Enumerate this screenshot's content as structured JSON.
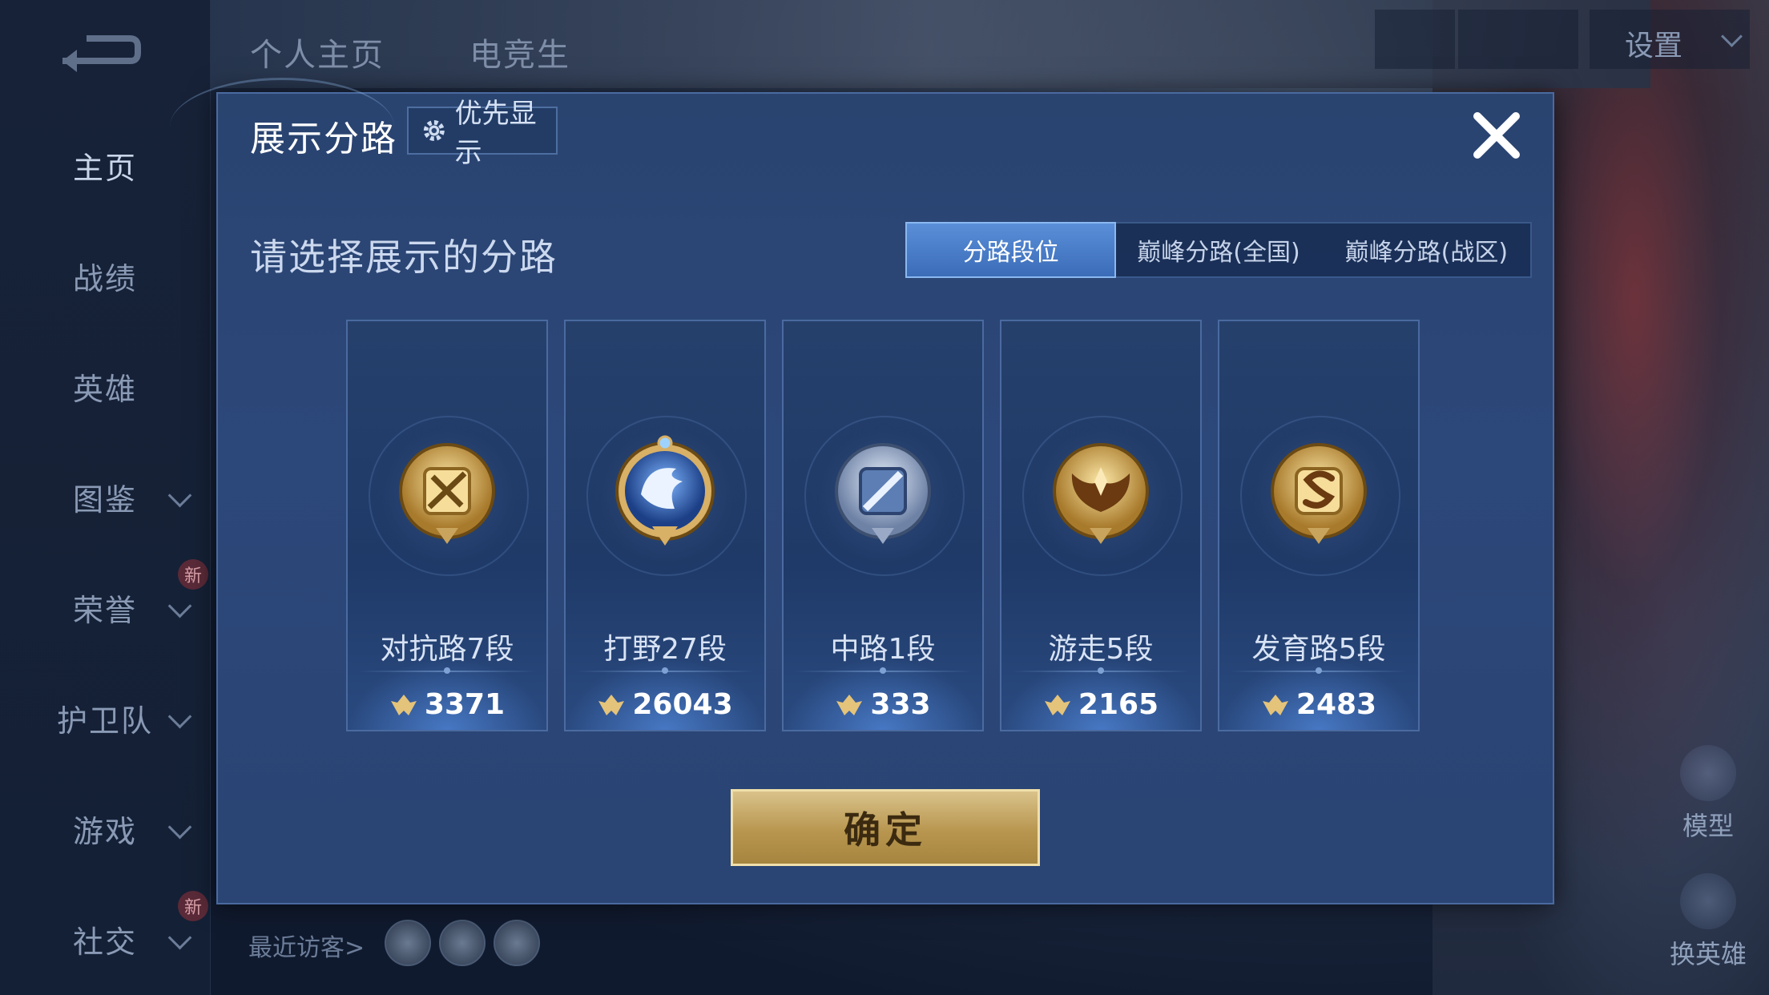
{
  "sidebar": {
    "items": [
      {
        "label": "主页",
        "chevron": false,
        "badge": ""
      },
      {
        "label": "战绩",
        "chevron": false,
        "badge": ""
      },
      {
        "label": "英雄",
        "chevron": false,
        "badge": ""
      },
      {
        "label": "图鉴",
        "chevron": true,
        "badge": ""
      },
      {
        "label": "荣誉",
        "chevron": true,
        "badge": "新"
      },
      {
        "label": "护卫队",
        "chevron": true,
        "badge": ""
      },
      {
        "label": "游戏",
        "chevron": true,
        "badge": ""
      },
      {
        "label": "社交",
        "chevron": true,
        "badge": "新"
      }
    ]
  },
  "header": {
    "tabs": [
      "个人主页",
      "电竞生"
    ],
    "settings_label": "设置"
  },
  "right_buttons": {
    "model_label": "模型",
    "switch_hero_label": "换英雄"
  },
  "footer": {
    "recent_visitors_label": "最近访客>"
  },
  "modal": {
    "title": "展示分路",
    "priority_label": "优先显示",
    "subtitle": "请选择展示的分路",
    "tabs": [
      "分路段位",
      "巅峰分路(全国)",
      "巅峰分路(战区)"
    ],
    "active_tab": 0,
    "lanes": [
      {
        "name": "对抗路7段",
        "score": "3371",
        "emblem": "sword-emblem-icon",
        "color": "gold"
      },
      {
        "name": "打野27段",
        "score": "26043",
        "emblem": "dragon-emblem-icon",
        "color": "blue"
      },
      {
        "name": "中路1段",
        "score": "333",
        "emblem": "staff-emblem-icon",
        "color": "silver"
      },
      {
        "name": "游走5段",
        "score": "2165",
        "emblem": "wings-emblem-icon",
        "color": "gold"
      },
      {
        "name": "发育路5段",
        "score": "2483",
        "emblem": "shield-s-emblem-icon",
        "color": "gold"
      }
    ],
    "confirm_label": "确定"
  },
  "colors": {
    "accent_blue": "#3b6cb8",
    "gold": "#c9a45c",
    "modal_bg": "#2c477a"
  }
}
